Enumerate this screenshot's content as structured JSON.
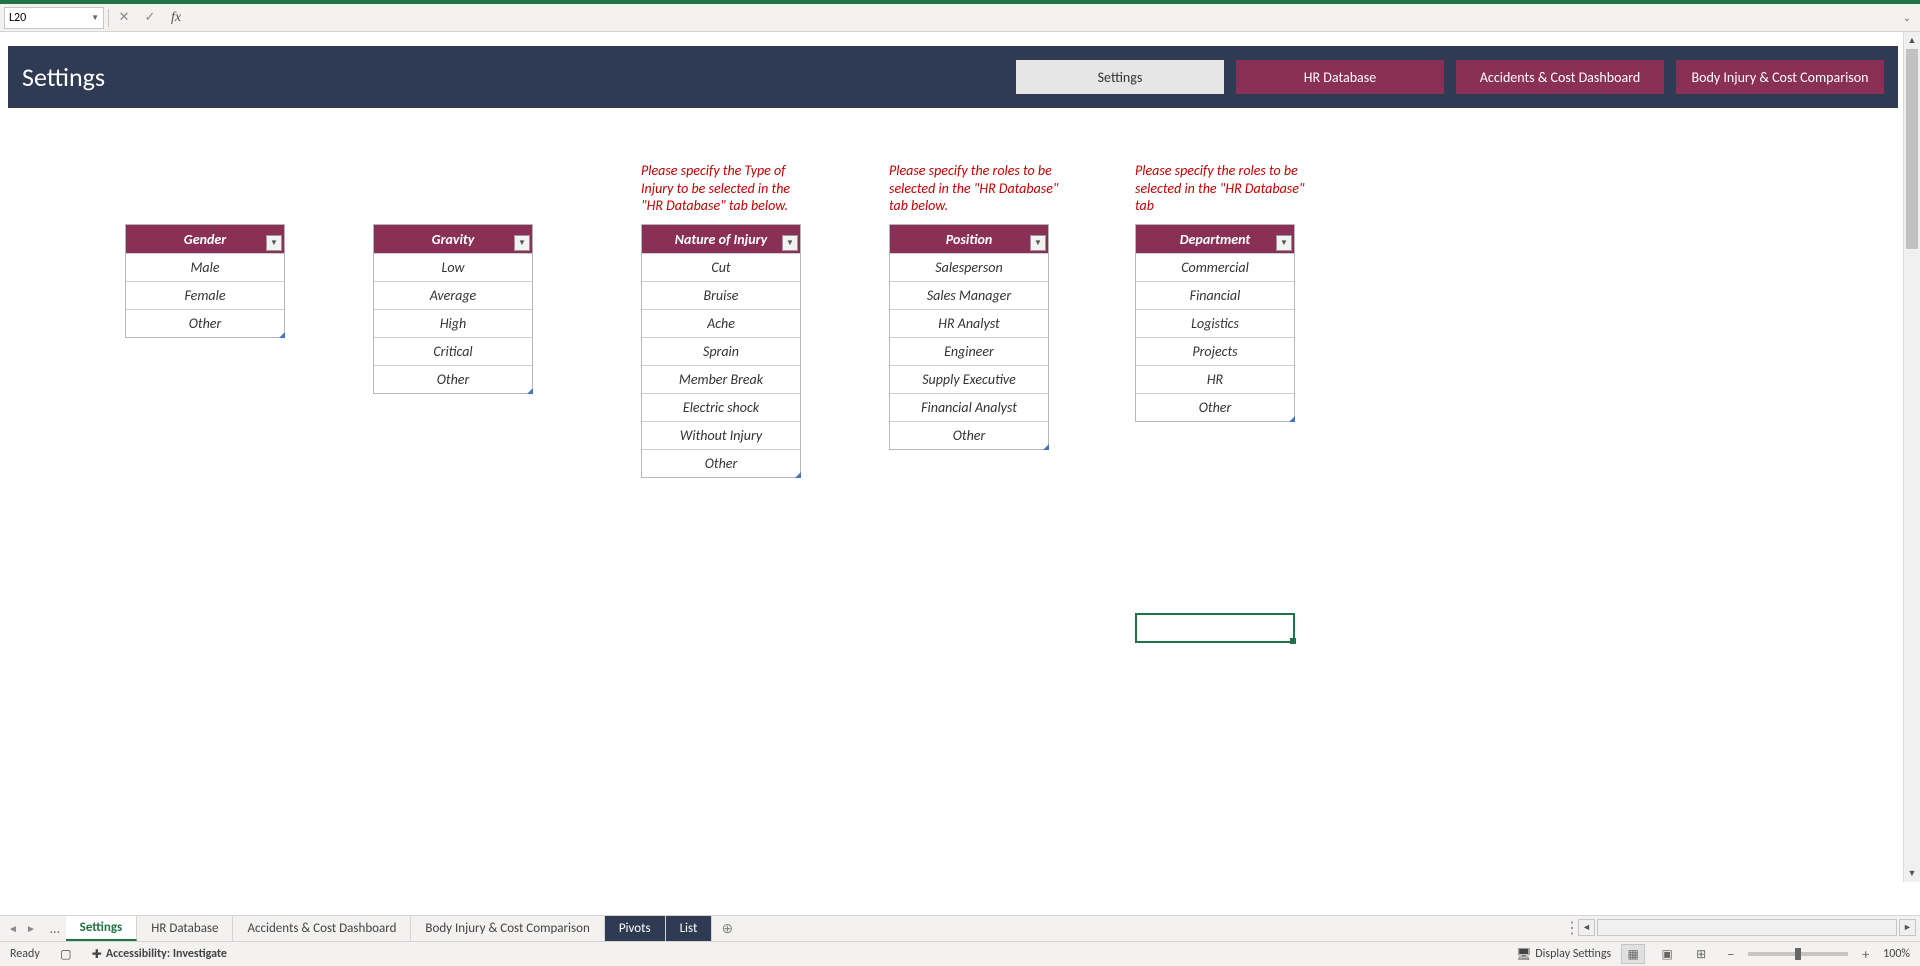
{
  "name_box": "L20",
  "formula_value": "",
  "band": {
    "title": "Settings",
    "tabs": [
      {
        "label": "Settings",
        "active": true
      },
      {
        "label": "HR Database",
        "active": false
      },
      {
        "label": "Accidents & Cost Dashboard",
        "active": false
      },
      {
        "label": "Body Injury & Cost Comparison",
        "active": false
      }
    ]
  },
  "hints": {
    "injury": "Please specify the Type of Injury to be selected in the \"HR Database\" tab below.",
    "position": "Please specify the roles to be selected in the \"HR Database\" tab below.",
    "department": "Please specify the roles to be selected in the \"HR Database\" tab"
  },
  "tables": {
    "gender": {
      "header": "Gender",
      "rows": [
        "Male",
        "Female",
        "Other"
      ]
    },
    "gravity": {
      "header": "Gravity",
      "rows": [
        "Low",
        "Average",
        "High",
        "Critical",
        "Other"
      ]
    },
    "nature": {
      "header": "Nature of Injury",
      "rows": [
        "Cut",
        "Bruise",
        "Ache",
        "Sprain",
        "Member Break",
        "Electric shock",
        "Without Injury",
        "Other"
      ]
    },
    "position": {
      "header": "Position",
      "rows": [
        "Salesperson",
        "Sales Manager",
        "HR Analyst",
        "Engineer",
        "Supply Executive",
        "Financial Analyst",
        "Other"
      ]
    },
    "department": {
      "header": "Department",
      "rows": [
        "Commercial",
        "Financial",
        "Logistics",
        "Projects",
        "HR",
        "Other"
      ]
    }
  },
  "sheet_tabs": [
    {
      "label": "Settings",
      "style": "active"
    },
    {
      "label": "HR Database",
      "style": ""
    },
    {
      "label": "Accidents & Cost Dashboard",
      "style": ""
    },
    {
      "label": "Body Injury & Cost Comparison",
      "style": ""
    },
    {
      "label": "Pivots",
      "style": "dark"
    },
    {
      "label": "List",
      "style": "dark"
    }
  ],
  "status": {
    "ready": "Ready",
    "accessibility": "Accessibility: Investigate",
    "display_settings": "Display Settings",
    "zoom": "100%"
  }
}
